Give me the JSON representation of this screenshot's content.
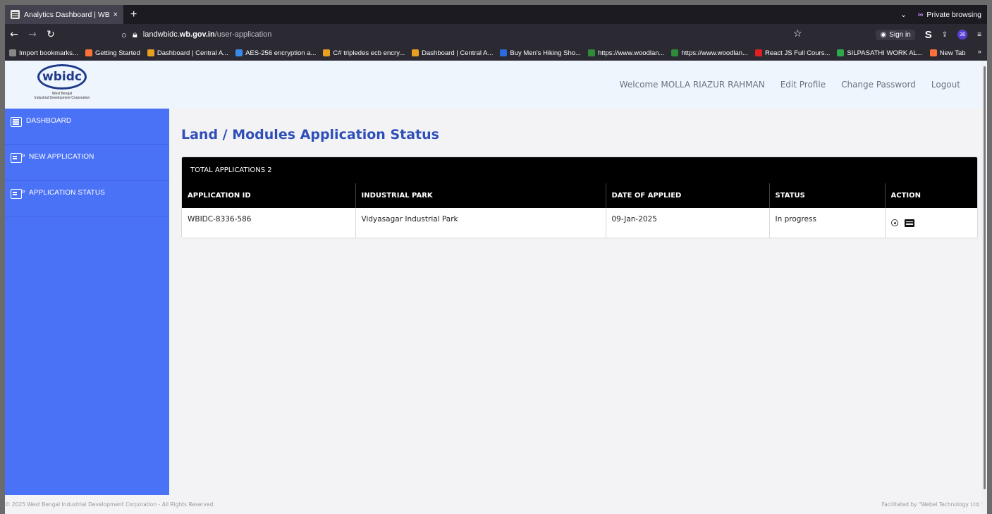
{
  "browser": {
    "tab_title": "Analytics Dashboard | WBIDC",
    "tab_close": "×",
    "new_tab": "+",
    "private_label": "Private browsing",
    "url_host_prefix": "landwbidc.",
    "url_host_bold": "wb.gov.in",
    "url_path": "/user-application",
    "signin_label": "Sign in",
    "ext_badge": "36",
    "bookmarks": [
      {
        "label": "Import bookmarks...",
        "color": "#888888"
      },
      {
        "label": "Getting Started",
        "color": "#ff7139"
      },
      {
        "label": "Dashboard | Central A...",
        "color": "#e8a020"
      },
      {
        "label": "AES-256 encryption a...",
        "color": "#3a8be8"
      },
      {
        "label": "C# tripledes ecb encry...",
        "color": "#e8a020"
      },
      {
        "label": "Dashboard | Central A...",
        "color": "#e8a020"
      },
      {
        "label": "Buy Men's Hiking Sho...",
        "color": "#2a6be0"
      },
      {
        "label": "https://www.woodlan...",
        "color": "#2e8b3a"
      },
      {
        "label": "https://www.woodlan...",
        "color": "#2e8b3a"
      },
      {
        "label": "React JS Full Cours...",
        "color": "#e02020"
      },
      {
        "label": "SILPASATHI WORK AL...",
        "color": "#2ea84a"
      },
      {
        "label": "New Tab",
        "color": "#ff7139"
      }
    ]
  },
  "header": {
    "logo_text": "wbidc",
    "logo_line1": "West Bengal",
    "logo_line2": "Industrial Development Corporation",
    "welcome": "Welcome MOLLA RIAZUR RAHMAN",
    "edit_profile": "Edit Profile",
    "change_password": "Change Password",
    "logout": "Logout"
  },
  "sidebar": {
    "items": [
      {
        "label": "DASHBOARD",
        "icon": "dashboard-icon"
      },
      {
        "label": "NEW APPLICATION",
        "icon": "new-application-icon"
      },
      {
        "label": "APPLICATION STATUS",
        "icon": "application-status-icon"
      }
    ]
  },
  "main": {
    "title": "Land / Modules Application Status",
    "total_label": "TOTAL APPLICATIONS 2",
    "columns": [
      "APPLICATION ID",
      "INDUSTRIAL PARK",
      "DATE OF APPLIED",
      "STATUS",
      "ACTION"
    ],
    "rows": [
      {
        "id": "WBIDC-8336-586",
        "park": "Vidyasagar Industrial Park",
        "date": "09-Jan-2025",
        "status": "In progress"
      }
    ]
  },
  "footer": {
    "left": "© 2025 West Bengal Industrial Development Corporation - All Rights Reserved.",
    "right": "Facilitated by \"Webel Technology Ltd.\""
  },
  "colors": {
    "sidebar": "#4a72f6",
    "title": "#2f4fb8",
    "table_header": "#000000"
  }
}
